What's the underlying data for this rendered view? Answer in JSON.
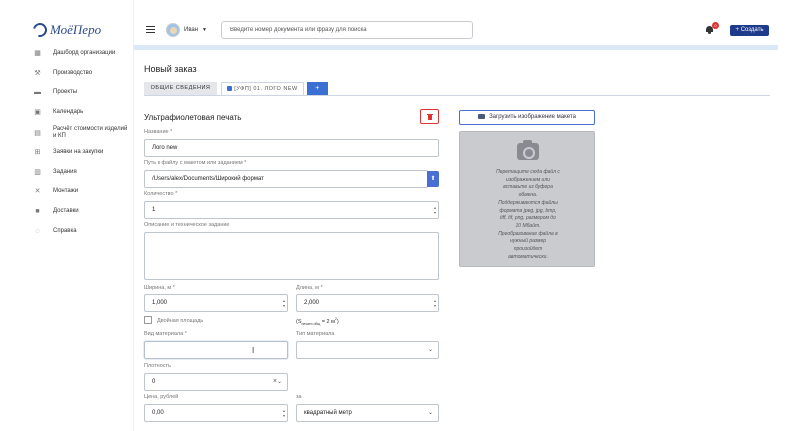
{
  "brand": {
    "name": "МоёПеро"
  },
  "sidebar": {
    "items": [
      {
        "label": "Дашборд организации",
        "icon": "dashboard-icon"
      },
      {
        "label": "Производство",
        "icon": "wrench-icon"
      },
      {
        "label": "Проекты",
        "icon": "briefcase-icon"
      },
      {
        "label": "Календарь",
        "icon": "calendar-icon"
      },
      {
        "label": "Расчёт стоимости изделий и КП",
        "icon": "calculator-icon"
      },
      {
        "label": "Заявки на закупки",
        "icon": "cart-icon"
      },
      {
        "label": "Задания",
        "icon": "document-icon"
      },
      {
        "label": "Монтажи",
        "icon": "tools-icon"
      },
      {
        "label": "Доставки",
        "icon": "truck-icon"
      },
      {
        "label": "Справка",
        "icon": "help-icon"
      }
    ]
  },
  "header": {
    "user_name": "Иван",
    "search_placeholder": "Введите номер документа или фразу для поиска",
    "notification_count": "0",
    "create_label": "Создать"
  },
  "page": {
    "title": "Новый заказ",
    "tabs": [
      {
        "label": "ОБЩИЕ СВЕДЕНИЯ"
      },
      {
        "label": "[УФП] 01. ЛОГО NEW"
      },
      {
        "label": "+"
      }
    ]
  },
  "form": {
    "section_title": "Ультрафиолетовая печать",
    "name_label": "Название *",
    "name_value": "Лого new",
    "path_label": "Путь к файлу с макетом или заданием *",
    "path_value": "/Users/alex/Documents/Широкий формат",
    "quantity_label": "Количество *",
    "quantity_value": "1",
    "description_label": "Описание и техническое задание",
    "width_label": "Ширина, м *",
    "width_value": "1,000",
    "length_label": "Длина, м *",
    "length_value": "2,000",
    "double_area_label": "Двойная площадь",
    "area_prefix": "(S",
    "area_sub": "печати общ",
    "area_mid": " = 2 м",
    "area_sup": "2",
    "area_suffix": ")",
    "material_kind_label": "Вид материала *",
    "material_kind_value": "",
    "material_type_label": "Тип материала",
    "material_type_value": "",
    "density_label": "Плотность",
    "density_value": "0",
    "price_label": "Цена, рублей",
    "price_value": "0,00",
    "per_label": "за",
    "per_value": "квадратный метр"
  },
  "upload": {
    "button_label": "Загрузить изображение макета",
    "lines": [
      "Перетащите сюда файл с",
      "изображением или",
      "вставьте из буфера",
      "обмена.",
      "Поддерживаются файлы",
      "формата jpeg, jpg, bmp,",
      "tiff, tif, png, размером до",
      "10 Мбайт.",
      "Преобразование файла в",
      "нужный размер",
      "произойдет",
      "автоматически."
    ]
  },
  "colors": {
    "brand": "#2b4a8c",
    "primary": "#1e3a8a",
    "accent": "#3b6fd1",
    "danger": "#dd3333",
    "header_strip": "#dbe8f6"
  }
}
